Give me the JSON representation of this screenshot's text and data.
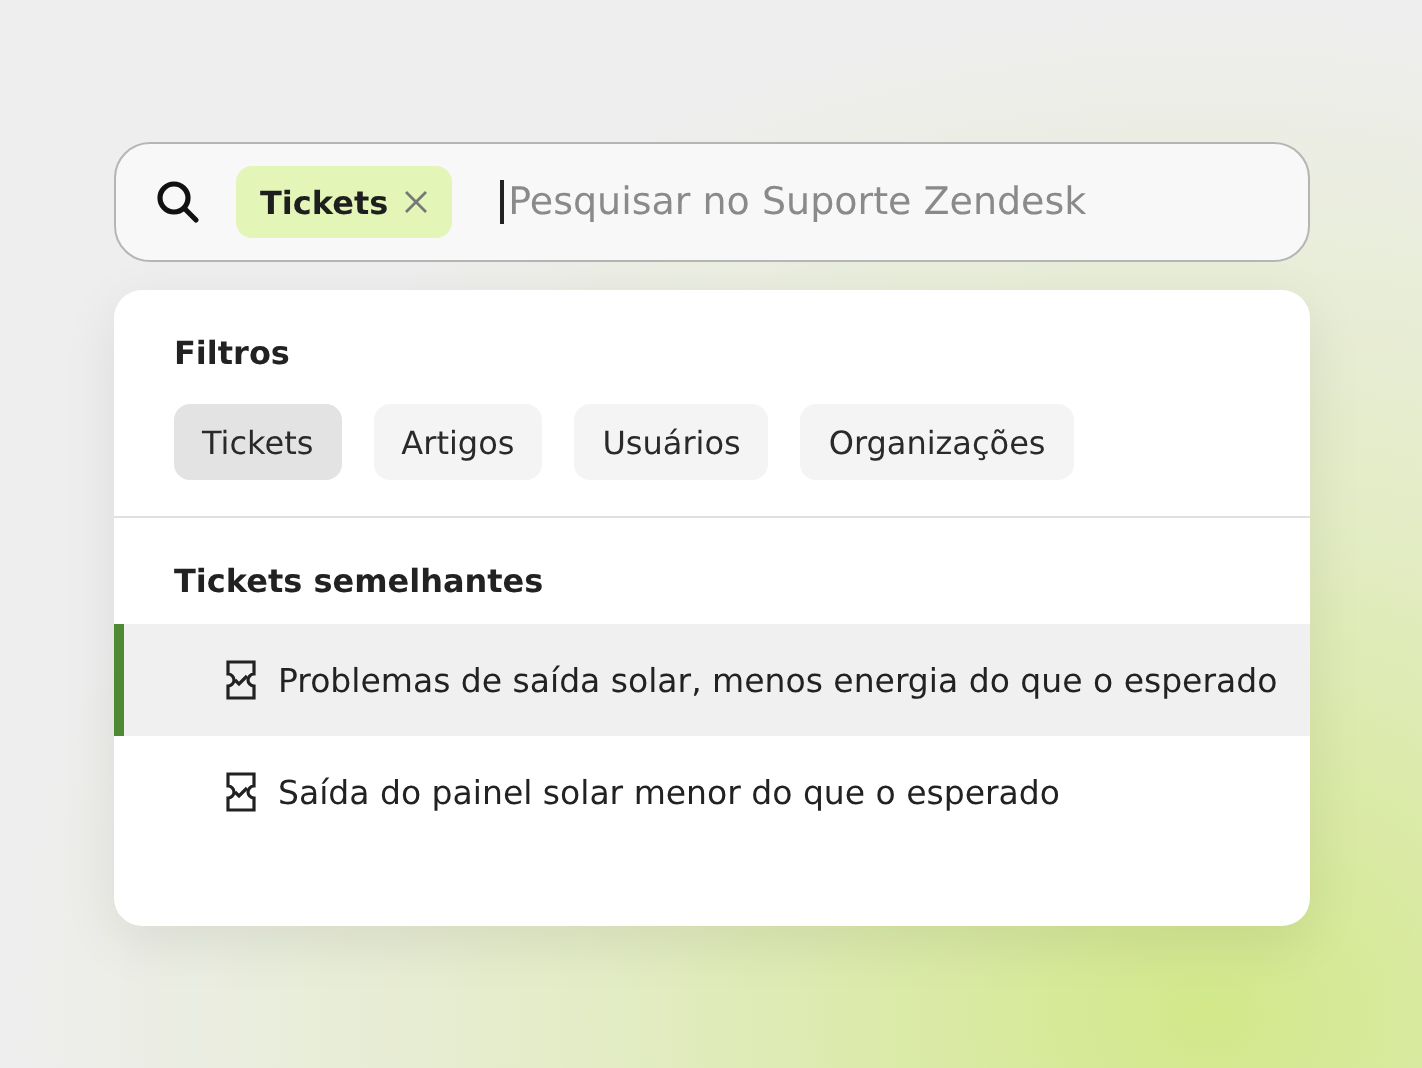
{
  "search": {
    "chip": {
      "label": "Tickets"
    },
    "placeholder": "Pesquisar no Suporte Zendesk"
  },
  "filters": {
    "title": "Filtros",
    "items": [
      {
        "label": "Tickets",
        "selected": true
      },
      {
        "label": "Artigos",
        "selected": false
      },
      {
        "label": "Usuários",
        "selected": false
      },
      {
        "label": "Organizações",
        "selected": false
      }
    ]
  },
  "similar": {
    "title": "Tickets semelhantes",
    "items": [
      {
        "label": "Problemas de saída solar, menos energia do que o esperado",
        "selected": true
      },
      {
        "label": "Saída do painel solar menor do que o esperado",
        "selected": false
      }
    ]
  }
}
